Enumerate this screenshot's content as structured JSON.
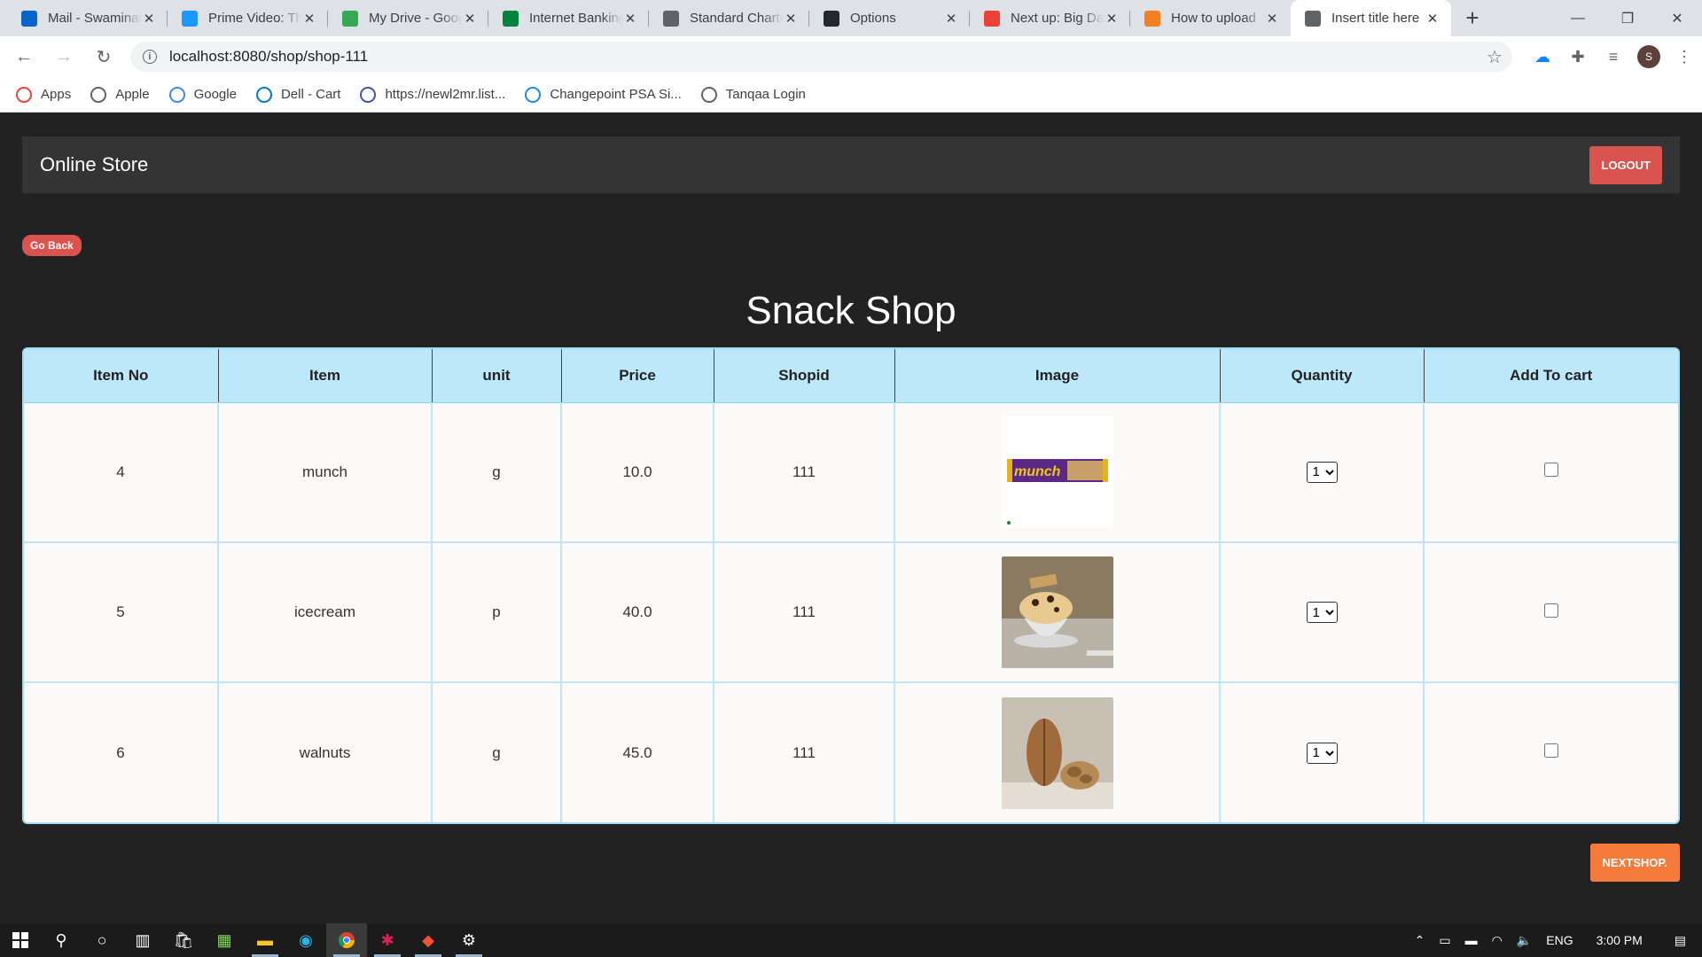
{
  "browser": {
    "tabs": [
      {
        "title": "Mail - Swaminathan",
        "icon": "outlook-icon",
        "color": "#0a64c8"
      },
      {
        "title": "Prime Video: Th",
        "icon": "prime-video-icon",
        "color": "#1a98ff"
      },
      {
        "title": "My Drive - Google",
        "icon": "google-drive-icon",
        "color": "#34a853"
      },
      {
        "title": "Internet Banking",
        "icon": "bank-icon",
        "color": "#00843d"
      },
      {
        "title": "Standard Chartered",
        "icon": "globe-icon",
        "color": "#5f6368"
      },
      {
        "title": "Options",
        "icon": "github-icon",
        "color": "#24292e"
      },
      {
        "title": "Next up: Big Da",
        "icon": "gmail-icon",
        "color": "#ea4335"
      },
      {
        "title": "How to upload",
        "icon": "stackoverflow-icon",
        "color": "#f48024"
      },
      {
        "title": "Insert title here",
        "icon": "globe-icon",
        "color": "#5f6368"
      }
    ],
    "active_tab": 8,
    "close_glyph": "✕",
    "new_tab_glyph": "+",
    "url": "localhost:8080/shop/shop-111",
    "profile_initial": "S"
  },
  "bookmarks": [
    {
      "label": "Apps",
      "icon": "apps-grid-icon",
      "color": "#ea4335"
    },
    {
      "label": "Apple",
      "icon": "apple-icon",
      "color": "#5f6368"
    },
    {
      "label": "Google",
      "icon": "google-icon",
      "color": "#4285f4"
    },
    {
      "label": "Dell - Cart",
      "icon": "dell-icon",
      "color": "#0076ce"
    },
    {
      "label": "https://newl2mr.list...",
      "icon": "list-site-icon",
      "color": "#3f51b5"
    },
    {
      "label": "Changepoint PSA Si...",
      "icon": "changepoint-icon",
      "color": "#1e88e5"
    },
    {
      "label": "Tanqaa Login",
      "icon": "globe-icon",
      "color": "#5f6368"
    }
  ],
  "app": {
    "brand": "Online Store",
    "logout_label": "LOGOUT",
    "go_back_label": "Go Back",
    "title": "Snack Shop",
    "next_shop_label": "NEXTSHOP.",
    "columns": [
      "Item No",
      "Item",
      "unit",
      "Price",
      "Shopid",
      "Image",
      "Quantity",
      "Add To cart"
    ],
    "rows": [
      {
        "item_no": "4",
        "item": "munch",
        "unit": "g",
        "price": "10.0",
        "shopid": "111",
        "image": "munch-chocolate-bar-image",
        "quantity": "1",
        "in_cart": false
      },
      {
        "item_no": "5",
        "item": "icecream",
        "unit": "p",
        "price": "40.0",
        "shopid": "111",
        "image": "icecream-sundae-image",
        "quantity": "1",
        "in_cart": false
      },
      {
        "item_no": "6",
        "item": "walnuts",
        "unit": "g",
        "price": "45.0",
        "shopid": "111",
        "image": "walnuts-image",
        "quantity": "1",
        "in_cart": false
      }
    ],
    "colors": {
      "danger": "#d9534f",
      "warning": "#f47b3a",
      "table_header": "#bde8fa",
      "table_border": "#9fdbf3"
    }
  },
  "taskbar": {
    "apps": [
      "start-icon",
      "search-icon",
      "cortana-icon",
      "task-view-icon",
      "store-icon",
      "terminal-icon",
      "file-explorer-icon",
      "edge-icon",
      "chrome-icon",
      "slack-icon",
      "git-icon",
      "settings-icon"
    ],
    "language": "ENG",
    "time": "3:00 PM"
  }
}
